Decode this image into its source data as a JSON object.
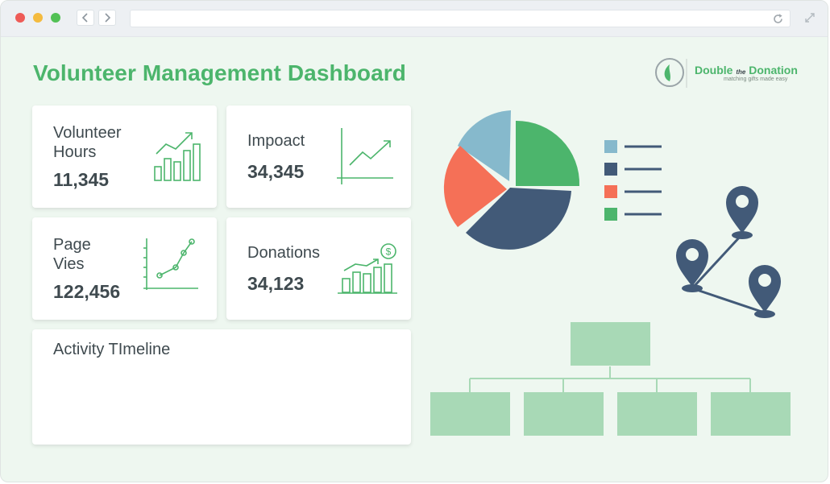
{
  "browser": {
    "dots": [
      "#ee5b57",
      "#f4bb3f",
      "#52c155"
    ]
  },
  "dashboard": {
    "title": "Volunteer Management Dashboard",
    "brand": {
      "name_left": "Double",
      "name_mid": "the",
      "name_right": "Donation",
      "tagline": "matching gifts made easy"
    },
    "cards": [
      {
        "label_line1": "Volunteer",
        "label_line2": "Hours",
        "value": "11,345",
        "icon": "bar-chart-up-icon"
      },
      {
        "label_line1": "Impoact",
        "value": "34,345",
        "icon": "line-chart-up-icon"
      },
      {
        "label_line1": "Page",
        "label_line2": "Vies",
        "value": "122,456",
        "icon": "scatter-line-icon"
      },
      {
        "label_line1": "Donations",
        "value": "34,123",
        "icon": "dollar-bar-chart-icon"
      }
    ],
    "timeline": {
      "label": "Activity TImeline"
    }
  },
  "colors": {
    "accent": "#4cb56c",
    "pie": [
      "#86b9cc",
      "#4cb56c",
      "#425a78",
      "#f57057"
    ],
    "pin": "#425a78",
    "org_box": "#a8d9b6"
  }
}
